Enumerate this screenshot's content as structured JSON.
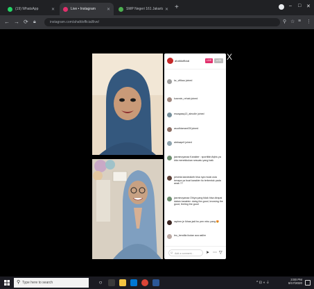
{
  "browser": {
    "tabs": [
      {
        "label": "(19) WhatsApp",
        "color": "#25d366"
      },
      {
        "label": "Live • Instagram",
        "color": "#e1306c"
      },
      {
        "label": "SMP Negeri 161 Jakarta on Mav...",
        "color": "#4caf50"
      }
    ],
    "new_tab": "+",
    "window_controls": {
      "minimize": "–",
      "maximize": "□",
      "close": "✕"
    },
    "url": "instagram.com/ahafdofficial/live/"
  },
  "live": {
    "username": "ahafdofficial",
    "live_badge": "LIVE",
    "viewer_count": "● 63",
    "close": "X",
    "comments": [
      {
        "user_text": "kz_vifikau joined",
        "color": "#9e9e9e"
      },
      {
        "user_text": "kusnnin_rehab joined",
        "color": "#a1887f"
      },
      {
        "user_text": "essayaaq13_aleudle joined",
        "color": "#78909c"
      },
      {
        "user_text": "asudhiaman03f joined",
        "color": "#8d6e63"
      },
      {
        "user_text": "aleksapril joined",
        "color": "#90a4ae"
      },
      {
        "user_text": "jasminoyanaa Karakter : sportifah,fiqhis ya kita menekkukan sesuatu yang baik",
        "color": "#6d8e6f"
      },
      {
        "user_text": "pesinta kandeakeb bisa nya mulai usia berapa ya buat karakter itu terbentuk pada anak ??",
        "color": "#5d4037"
      },
      {
        "user_text": "jasminoyanaa Ohiya yang tidak bisa dirapai dalam karakter: doing the good, knowing the good, feeling the good",
        "color": "#6d8e6f"
      },
      {
        "user_text": "raphen.je Ikhas jadi bu pen mbu yang 😍",
        "color": "#3e2723"
      },
      {
        "user_text": "leo_bendila ikutan aca asilim",
        "color": "#bcaaa4"
      }
    ],
    "comment_placeholder": "Add a comment..."
  },
  "taskbar": {
    "search_placeholder": "Type here to search",
    "time": "3:00 PM",
    "date": "8/17/2020"
  },
  "colors": {
    "chrome_bg": "#202124",
    "toolbar_bg": "#35363a",
    "instagram_accent": "#e1306c"
  }
}
